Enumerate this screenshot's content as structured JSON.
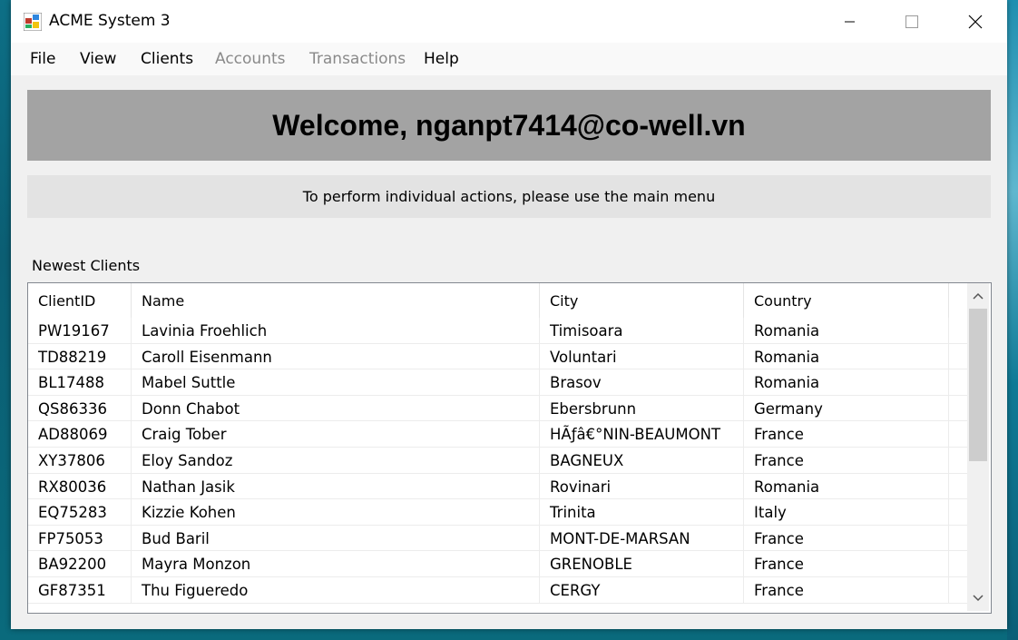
{
  "window": {
    "title": "ACME System 3",
    "minimize_glyph": "—",
    "maximize_glyph": "☐",
    "close_glyph": "✕"
  },
  "menu": {
    "items": [
      {
        "label": "File",
        "enabled": true
      },
      {
        "label": "View",
        "enabled": true
      },
      {
        "label": "Clients",
        "enabled": true
      },
      {
        "label": "Accounts",
        "enabled": false
      },
      {
        "label": "Transactions",
        "enabled": false
      },
      {
        "label": "Help",
        "enabled": true
      }
    ]
  },
  "banner": {
    "welcome": "Welcome, nganpt7414@co-well.vn",
    "info": "To perform individual actions, please use the main menu"
  },
  "clients": {
    "section_label": "Newest Clients",
    "columns": [
      "ClientID",
      "Name",
      "City",
      "Country"
    ],
    "rows": [
      [
        "PW19167",
        "Lavinia Froehlich",
        "Timisoara",
        "Romania"
      ],
      [
        "TD88219",
        "Caroll Eisenmann",
        "Voluntari",
        "Romania"
      ],
      [
        "BL17488",
        "Mabel Suttle",
        "Brasov",
        "Romania"
      ],
      [
        "QS86336",
        "Donn Chabot",
        "Ebersbrunn",
        "Germany"
      ],
      [
        "AD88069",
        "Craig Tober",
        "HÃƒâ€°NIN-BEAUMONT",
        "France"
      ],
      [
        "XY37806",
        "Eloy Sandoz",
        "BAGNEUX",
        "France"
      ],
      [
        "RX80036",
        "Nathan Jasik",
        "Rovinari",
        "Romania"
      ],
      [
        "EQ75283",
        "Kizzie Kohen",
        "Trinita",
        "Italy"
      ],
      [
        "FP75053",
        "Bud Baril",
        "MONT-DE-MARSAN",
        "France"
      ],
      [
        "BA92200",
        "Mayra Monzon",
        "GRENOBLE",
        "France"
      ],
      [
        "GF87351",
        "Thu Figueredo",
        "CERGY",
        "France"
      ]
    ]
  },
  "colors": {
    "banner_bg": "#a3a3a3",
    "info_bg": "#e3e3e3",
    "disabled_menu": "#8a8a8a",
    "window_bg": "#f0f0f0"
  }
}
